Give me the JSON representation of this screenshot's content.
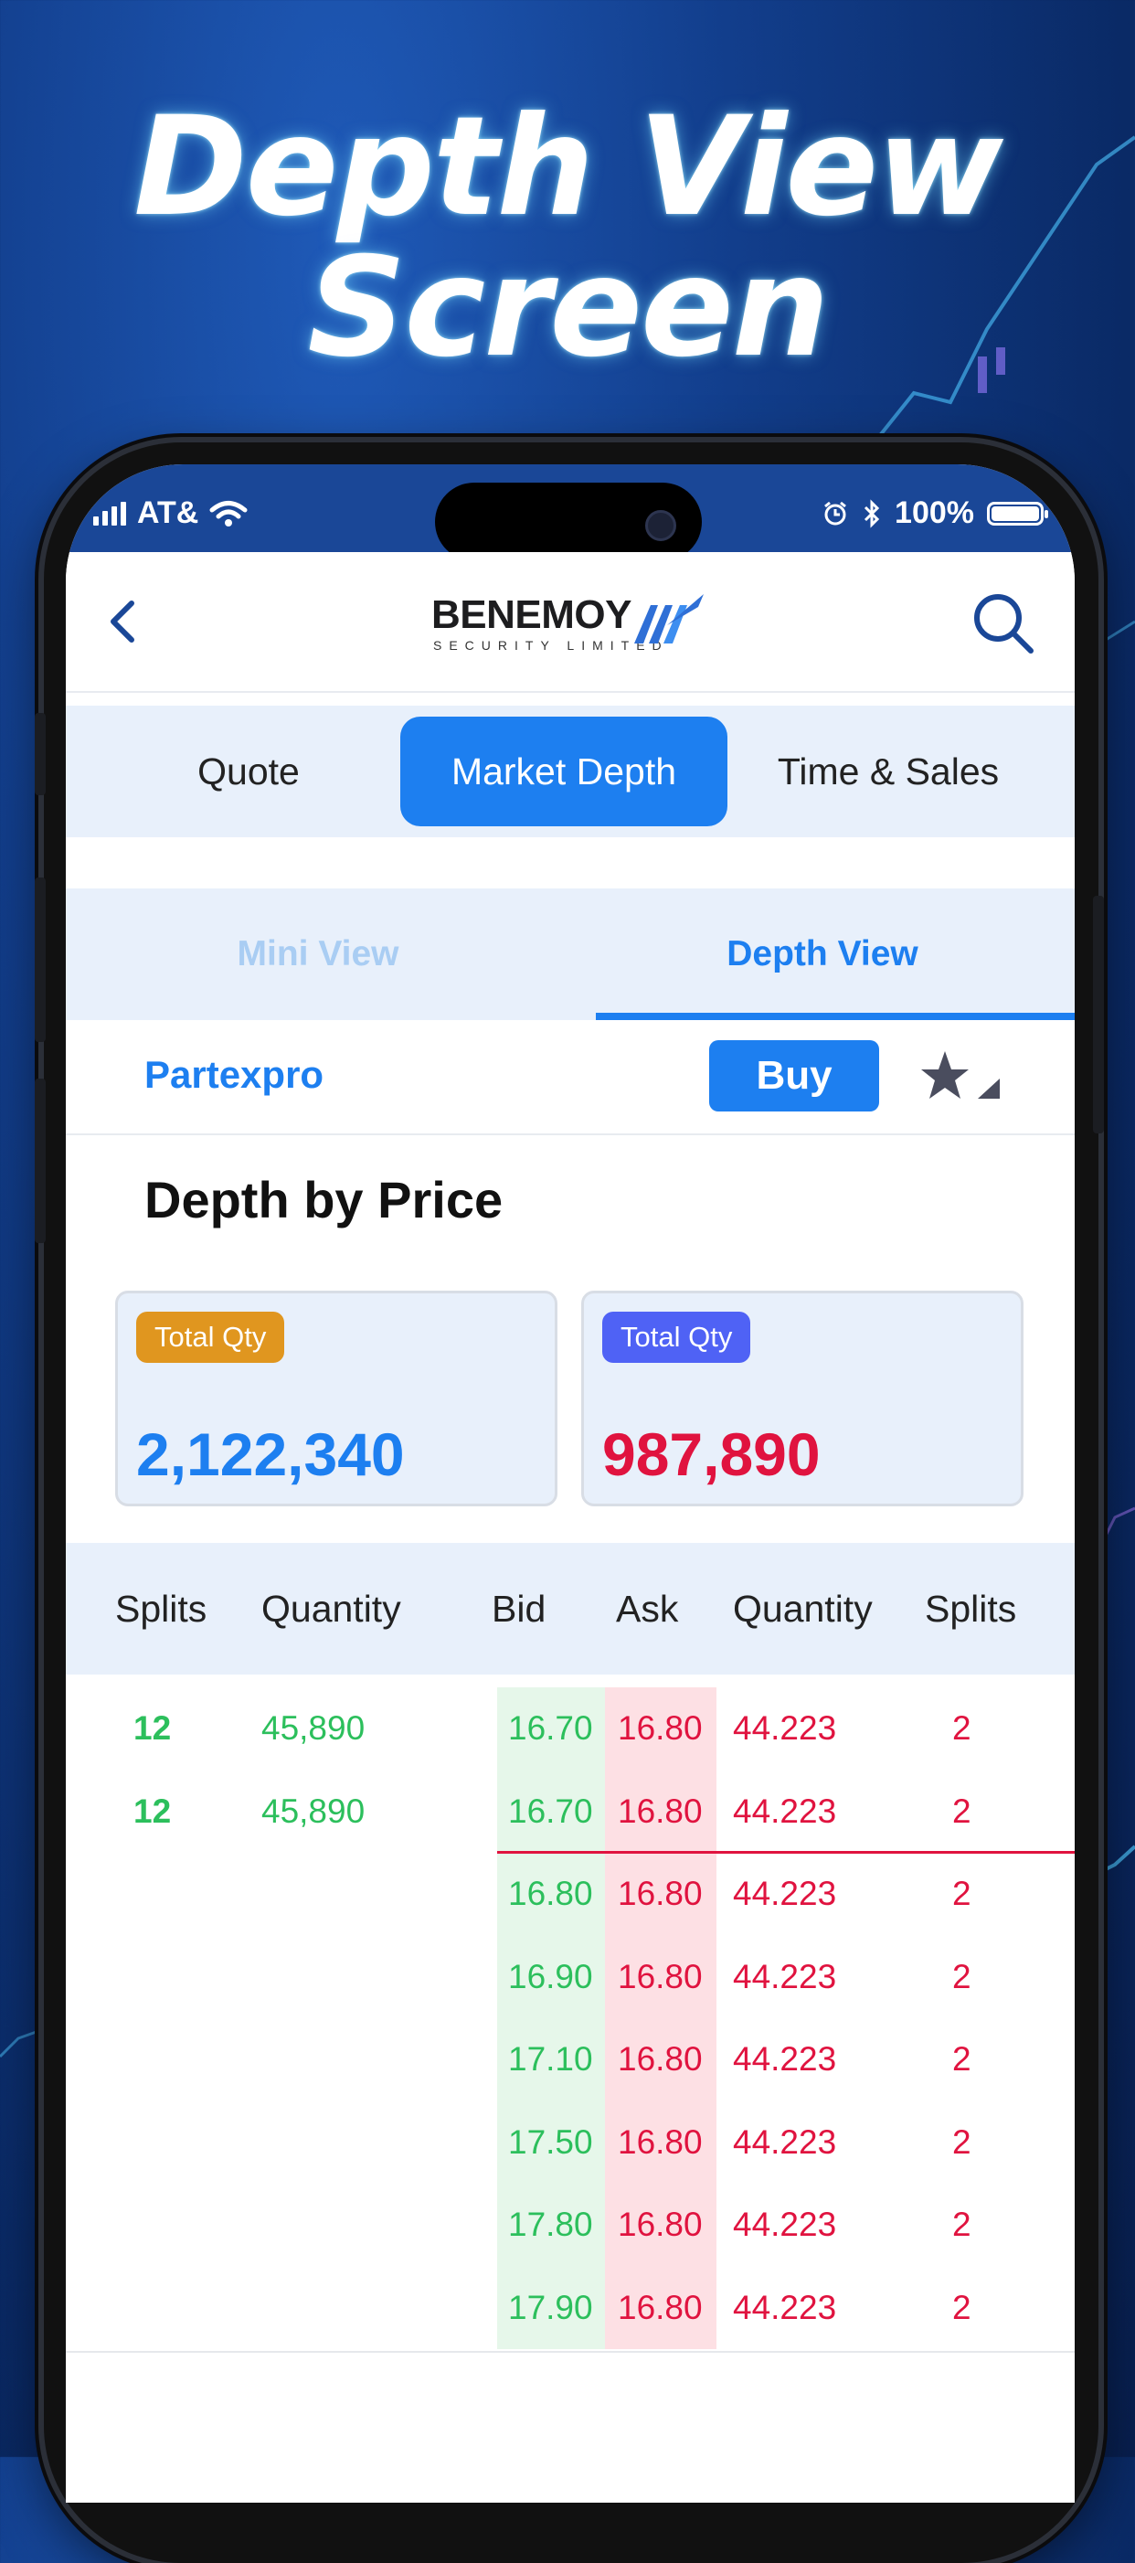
{
  "headline": {
    "line1": "Depth View",
    "line2": "Screen"
  },
  "status_bar": {
    "carrier": "AT&",
    "battery": "100%",
    "battery_level": 1.0
  },
  "app_bar": {
    "logo_name": "BENEMOY",
    "logo_sub": "SECURITY LIMITED",
    "icons": [
      "back-icon",
      "search-icon"
    ]
  },
  "main_tabs": [
    {
      "label": "Quote",
      "active": false
    },
    {
      "label": "Market Depth",
      "active": true
    },
    {
      "label": "Time & Sales",
      "active": false
    }
  ],
  "sub_tabs": [
    {
      "label": "Mini View",
      "active": false
    },
    {
      "label": "Depth View",
      "active": true
    }
  ],
  "symbol_row": {
    "symbol": "Partexpro",
    "buy_label": "Buy",
    "icons": [
      "star-icon",
      "dropdown-triangle-icon"
    ]
  },
  "section_title": "Depth by Price",
  "totals": {
    "bid": {
      "badge": "Total Qty",
      "value": "2,122,340",
      "badge_color": "#e0961f",
      "value_color": "#1d7ff0"
    },
    "ask": {
      "badge": "Total Qty",
      "value": "987,890",
      "badge_color": "#4f62f5",
      "value_color": "#e0133f"
    }
  },
  "table": {
    "headers": [
      "Splits",
      "Quantity",
      "Bid",
      "Ask",
      "Quantity",
      "Splits"
    ],
    "rows": [
      {
        "bid_splits": "12",
        "bid_qty": "45,890",
        "bid": "16.70",
        "ask": "16.80",
        "ask_qty": "44.223",
        "ask_splits": "2"
      },
      {
        "bid_splits": "12",
        "bid_qty": "45,890",
        "bid": "16.70",
        "ask": "16.80",
        "ask_qty": "44.223",
        "ask_splits": "2"
      },
      {
        "bid_splits": "",
        "bid_qty": "",
        "bid": "16.80",
        "ask": "16.80",
        "ask_qty": "44.223",
        "ask_splits": "2"
      },
      {
        "bid_splits": "",
        "bid_qty": "",
        "bid": "16.90",
        "ask": "16.80",
        "ask_qty": "44.223",
        "ask_splits": "2"
      },
      {
        "bid_splits": "",
        "bid_qty": "",
        "bid": "17.10",
        "ask": "16.80",
        "ask_qty": "44.223",
        "ask_splits": "2"
      },
      {
        "bid_splits": "",
        "bid_qty": "",
        "bid": "17.50",
        "ask": "16.80",
        "ask_qty": "44.223",
        "ask_splits": "2"
      },
      {
        "bid_splits": "",
        "bid_qty": "",
        "bid": "17.80",
        "ask": "16.80",
        "ask_qty": "44.223",
        "ask_splits": "2"
      },
      {
        "bid_splits": "",
        "bid_qty": "",
        "bid": "17.90",
        "ask": "16.80",
        "ask_qty": "44.223",
        "ask_splits": "2"
      }
    ]
  },
  "colors": {
    "accent": "#1d7ff0",
    "bid_green": "#2cbf5c",
    "ask_red": "#e0133f",
    "status_bar": "#1a4797"
  }
}
